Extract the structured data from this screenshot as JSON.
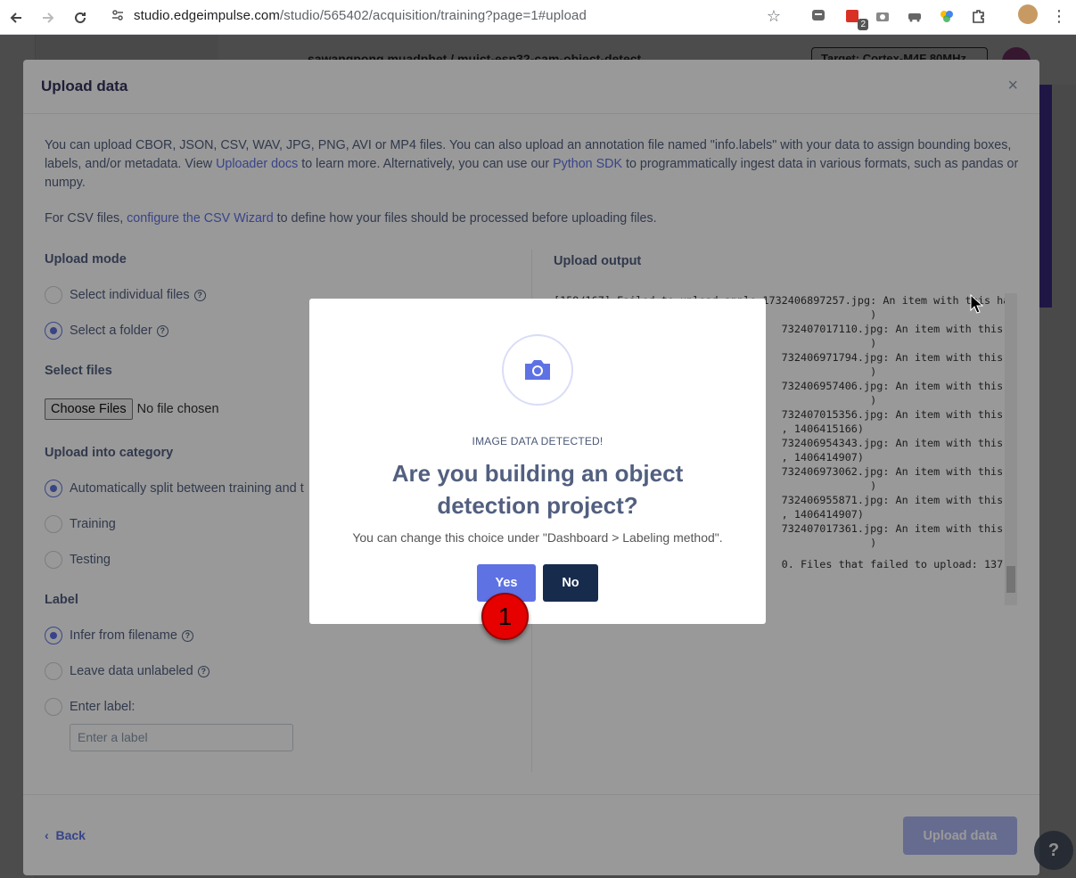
{
  "browser": {
    "url_host": "studio.edgeimpulse.com",
    "url_path": "/studio/565402/acquisition/training?page=1#upload",
    "ext_badge": "2"
  },
  "background_app": {
    "project": "sawangpong muadphet / muict-esp32-cam-object-detect",
    "target": "Target: Cortex-M4F 80MHz"
  },
  "upload_modal": {
    "title": "Upload data",
    "close": "×",
    "intro_part1": "You can upload CBOR, JSON, CSV, WAV, JPG, PNG, AVI or MP4 files. You can also upload an annotation file named \"info.labels\" with your data to assign bounding boxes, labels, and/or metadata. View ",
    "uploader_docs": "Uploader docs",
    "intro_part2": " to learn more. Alternatively, you can use our ",
    "python_sdk": "Python SDK",
    "intro_part3": " to programmatically ingest data in various formats, such as pandas or numpy.",
    "csv_part1": "For CSV files, ",
    "csv_link": "configure the CSV Wizard",
    "csv_part2": " to define how your files should be processed before uploading files.",
    "upload_mode_label": "Upload mode",
    "mode_individual": "Select individual files",
    "mode_folder": "Select a folder",
    "select_files_label": "Select files",
    "choose_files": "Choose Files",
    "no_file": "No file chosen",
    "category_label": "Upload into category",
    "cat_auto": "Automatically split between training and t",
    "cat_training": "Training",
    "cat_testing": "Testing",
    "label_label": "Label",
    "label_infer": "Infer from filename",
    "label_unlabeled": "Leave data unlabeled",
    "label_enter": "Enter label:",
    "label_placeholder": "Enter a label",
    "output_title": "Upload output",
    "output_lines": [
      "[159/167] Failed to upload apple.1732406897257.jpg: An item with this ha",
      "                                                  )",
      "                                    732407017110.jpg: An item with this ha",
      "                                                  )",
      "                                    732406971794.jpg: An item with this ha",
      "                                                  )",
      "                                    732406957406.jpg: An item with this ha",
      "                                                  )",
      "                                    732407015356.jpg: An item with this ha",
      "                                    , 1406415166)",
      "                                    732406954343.jpg: An item with this ha",
      "                                    , 1406414907)",
      "                                    732406973062.jpg: An item with this ha",
      "                                                  )",
      "                                    732406955871.jpg: An item with this ha",
      "                                    , 1406414907)",
      "                                    732407017361.jpg: An item with this ha",
      "                                                  )",
      "",
      "                                    0. Files that failed to upload: 137."
    ],
    "back": "Back",
    "upload_button": "Upload data"
  },
  "dialog": {
    "detected": "IMAGE DATA DETECTED!",
    "question": "Are you building an object detection project?",
    "hint": "You can change this choice under \"Dashboard > Labeling method\".",
    "yes": "Yes",
    "no": "No"
  },
  "marker": {
    "number": "1"
  },
  "colors": {
    "accent": "#5e72e4",
    "dark": "#172b4d",
    "marker": "#e60000"
  }
}
